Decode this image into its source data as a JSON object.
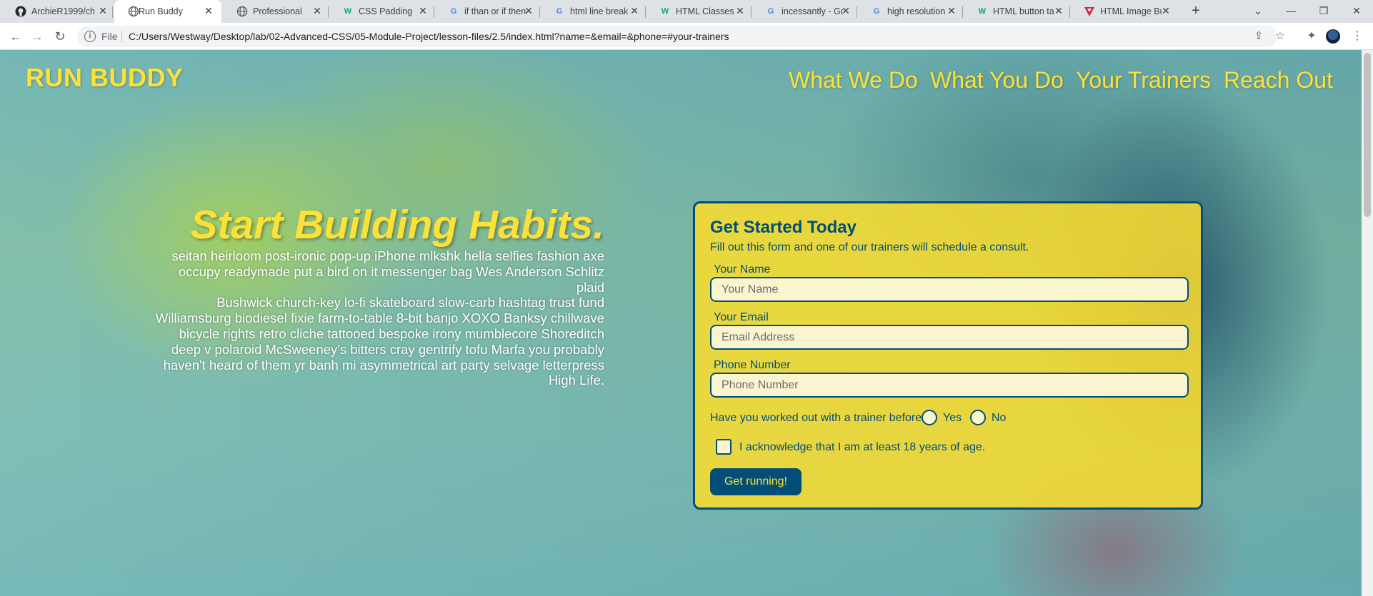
{
  "browser": {
    "tabs": [
      {
        "title": "ArchieR1999/ch",
        "icon": "github-icon",
        "active": false
      },
      {
        "title": "Run Buddy",
        "icon": "globe-icon",
        "active": true
      },
      {
        "title": "Professional Por",
        "icon": "globe-icon",
        "active": false
      },
      {
        "title": "CSS Padding",
        "icon": "w3schools-icon",
        "active": false
      },
      {
        "title": "if than or if then",
        "icon": "google-icon",
        "active": false
      },
      {
        "title": "html line break",
        "icon": "google-icon",
        "active": false
      },
      {
        "title": "HTML Classes -",
        "icon": "w3schools-icon",
        "active": false
      },
      {
        "title": "incessantly - Go",
        "icon": "google-icon",
        "active": false
      },
      {
        "title": "high resolution",
        "icon": "google-icon",
        "active": false
      },
      {
        "title": "HTML button ta",
        "icon": "w3schools-icon",
        "active": false
      },
      {
        "title": "HTML Image Bu",
        "icon": "triangle-icon",
        "active": false
      }
    ],
    "url_scheme": "File",
    "url": "C:/Users/Westway/Desktop/lab/02-Advanced-CSS/05-Module-Project/lesson-files/2.5/index.html?name=&email=&phone=#your-trainers"
  },
  "page": {
    "logo": "RUN BUDDY",
    "nav": [
      "What We Do",
      "What You Do",
      "Your Trainers",
      "Reach Out"
    ],
    "hero": {
      "title": "Start Building Habits.",
      "lines": [
        "seitan heirloom post-ironic pop-up iPhone mlkshk hella selfies fashion axe",
        "occupy readymade put a bird on it messenger bag Wes Anderson Schlitz plaid",
        "Bushwick church-key lo-fi skateboard slow-carb hashtag trust fund",
        "Williamsburg biodiesel fixie farm-to-table 8-bit banjo XOXO Banksy chillwave",
        "bicycle rights retro cliche tattooed bespoke irony mumblecore Shoreditch",
        "deep v polaroid McSweeney's bitters cray gentrify tofu Marfa you probably",
        "haven't heard of them yr banh mi asymmetrical art party selvage letterpress",
        "High Life."
      ]
    },
    "form": {
      "title": "Get Started Today",
      "subtitle": "Fill out this form and one of our trainers will schedule a consult.",
      "name_label": "Your Name",
      "name_placeholder": "Your Name",
      "email_label": "Your Email",
      "email_placeholder": "Email Address",
      "phone_label": "Phone Number",
      "phone_placeholder": "Phone Number",
      "question": "Have you worked out with a trainer before?",
      "option_yes": "Yes",
      "option_no": "No",
      "acknowledge": "I acknowledge that I am at least 18 years of age.",
      "submit": "Get running!"
    }
  },
  "colors": {
    "brand_yellow": "#fce138",
    "brand_navy": "#024e76"
  }
}
